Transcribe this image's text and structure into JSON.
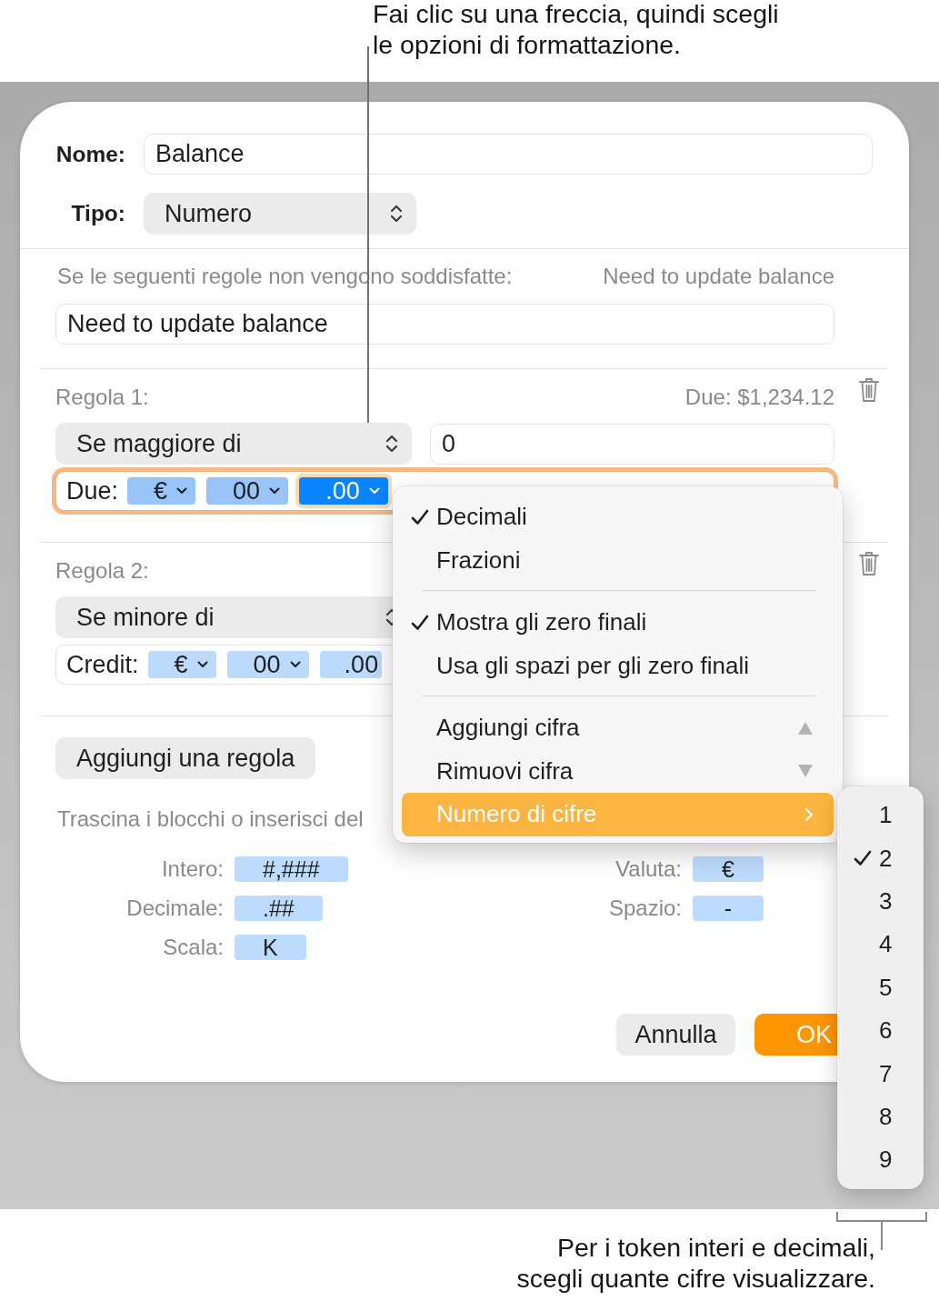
{
  "top_callout": {
    "text": "Fai clic su una freccia, quindi scegli le opzioni di formattazione."
  },
  "dialog": {
    "fields": [
      {
        "kind": "text",
        "label": "Nome:",
        "value": "Balance"
      },
      {
        "kind": "popup",
        "label": "Tipo:",
        "value": "Numero"
      }
    ],
    "condition": {
      "label": "Se le seguenti regole non vengono soddisfatte:",
      "preview": "Need to update balance",
      "value": "Need to update balance"
    },
    "rules": [
      {
        "title": "Regola 1:",
        "preview": "Due: $1,234.12",
        "operator": "Se maggiore di",
        "value": "0",
        "format": {
          "label": "Due:",
          "focused": true,
          "tokens": [
            {
              "kind": "popup",
              "text": "€",
              "selected": false
            },
            {
              "kind": "popup",
              "text": "00",
              "selected": false
            },
            {
              "kind": "popup",
              "text": ".00",
              "selected": true
            }
          ]
        }
      },
      {
        "title": "Regola 2:",
        "operator": "Se minore di",
        "format": {
          "label": "Credit:",
          "focused": false,
          "tokens": [
            {
              "kind": "popup",
              "text": "€",
              "selected": false
            },
            {
              "kind": "popup",
              "text": "00",
              "selected": false
            },
            {
              "kind": "plain",
              "text": ".00",
              "selected": false
            }
          ]
        }
      }
    ],
    "add_rule_button": {
      "label": "Aggiungi una regola"
    },
    "hint": "Trascina i blocchi o inserisci del",
    "token_groups": [
      {
        "items": [
          {
            "label": "Intero:",
            "token": "#,###"
          },
          {
            "label": "Decimale:",
            "token": ".##"
          },
          {
            "label": "Scala:",
            "token": "K"
          }
        ]
      },
      {
        "items": [
          {
            "label": "Valuta:",
            "token": "€"
          },
          {
            "label": "Spazio:",
            "token": "-"
          }
        ]
      }
    ],
    "buttons": [
      {
        "kind": "cancel",
        "label": "Annulla"
      },
      {
        "kind": "confirm",
        "label": "OK"
      }
    ]
  },
  "format_menu": {
    "items": [
      {
        "kind": "option",
        "label": "Decimali",
        "checked": true,
        "selected": false
      },
      {
        "kind": "option",
        "label": "Frazioni",
        "checked": false,
        "selected": false
      },
      {
        "kind": "separator"
      },
      {
        "kind": "option",
        "label": "Mostra gli zero finali",
        "checked": true,
        "selected": false
      },
      {
        "kind": "option",
        "label": "Usa gli spazi per gli zero finali",
        "checked": false,
        "selected": false
      },
      {
        "kind": "separator"
      },
      {
        "kind": "increase",
        "label": "Aggiungi cifra",
        "selected": false
      },
      {
        "kind": "decrease",
        "label": "Rimuovi cifra",
        "selected": false
      },
      {
        "kind": "submenu",
        "label": "Numero di cifre",
        "selected": true
      }
    ]
  },
  "digits_menu": {
    "items": [
      {
        "label": "1",
        "checked": false,
        "selected": false
      },
      {
        "label": "2",
        "checked": true,
        "selected": false
      },
      {
        "label": "3",
        "checked": false,
        "selected": false
      },
      {
        "label": "4",
        "checked": false,
        "selected": false
      },
      {
        "label": "5",
        "checked": false,
        "selected": false
      },
      {
        "label": "6",
        "checked": false,
        "selected": false
      },
      {
        "label": "7",
        "checked": false,
        "selected": false
      },
      {
        "label": "8",
        "checked": false,
        "selected": false
      },
      {
        "label": "9",
        "checked": false,
        "selected": false
      }
    ]
  },
  "bottom_callout": {
    "text": "Per i token interi e decimali, scegli quante cifre visualizzare."
  }
}
